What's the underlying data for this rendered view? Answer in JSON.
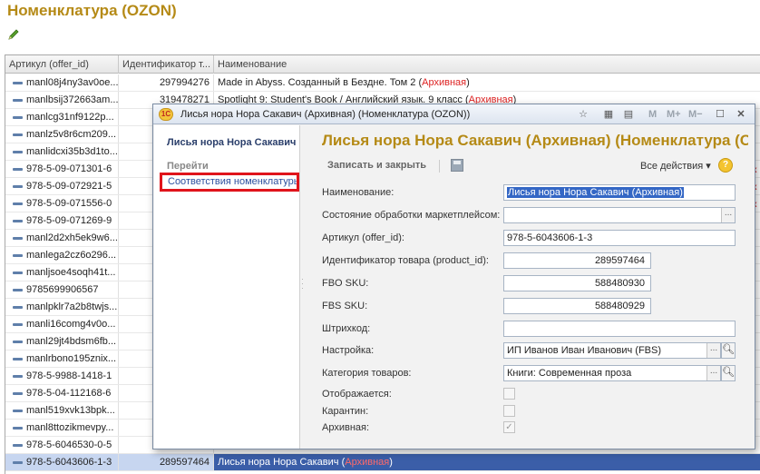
{
  "page": {
    "title": "Номенклатура (OZON)"
  },
  "grid": {
    "columns": [
      "Артикул (offer_id)",
      "Идентификатор т...",
      "Наименование"
    ],
    "rows": [
      {
        "art": "manl08j4ny3av0oe...",
        "id": "297994276",
        "name": "Made in Abyss. Созданный в Бездне. Том 2 (",
        "archive": "Архивная",
        "close": ")"
      },
      {
        "art": "manlbsij372663am...",
        "id": "319478271",
        "name": "Spotlight 9: Student's Book / Английский язык. 9 класс (",
        "archive": "Архивная",
        "close": ")"
      },
      {
        "art": "manlcg31nf9122p...",
        "id": "",
        "name": "",
        "archive": "",
        "close": ""
      },
      {
        "art": "manlz5v8r6cm209...",
        "id": "",
        "name": "",
        "archive": "",
        "close": ""
      },
      {
        "art": "manlidcxi35b3d1to...",
        "id": "",
        "name": "",
        "archive": "",
        "close": ""
      },
      {
        "art": "978-5-09-071301-6",
        "id": "",
        "name": "",
        "archive": "",
        "close": ""
      },
      {
        "art": "978-5-09-072921-5",
        "id": "",
        "name": "",
        "archive": "",
        "close": ""
      },
      {
        "art": "978-5-09-071556-0",
        "id": "",
        "name": "",
        "archive": "",
        "close": ""
      },
      {
        "art": "978-5-09-071269-9",
        "id": "",
        "name": "",
        "archive": "",
        "close": ""
      },
      {
        "art": "manl2d2xh5ek9w6...",
        "id": "",
        "name": "",
        "archive": "",
        "close": ""
      },
      {
        "art": "manlega2cz6o296...",
        "id": "",
        "name": "",
        "archive": "",
        "close": ""
      },
      {
        "art": "manljsoe4soqh41t...",
        "id": "",
        "name": "",
        "archive": "",
        "close": ""
      },
      {
        "art": "9785699906567",
        "id": "",
        "name": "",
        "archive": "",
        "close": ""
      },
      {
        "art": "manlpklr7a2b8twjs...",
        "id": "",
        "name": "",
        "archive": "",
        "close": ""
      },
      {
        "art": "manli16comg4v0o...",
        "id": "",
        "name": "",
        "archive": "",
        "close": ""
      },
      {
        "art": "manl29jt4bdsm6fb...",
        "id": "",
        "name": "",
        "archive": "",
        "close": ""
      },
      {
        "art": "manlrbono195znix...",
        "id": "",
        "name": "",
        "archive": "",
        "close": ""
      },
      {
        "art": "978-5-9988-1418-1",
        "id": "",
        "name": "",
        "archive": "",
        "close": ""
      },
      {
        "art": "978-5-04-112168-6",
        "id": "",
        "name": "",
        "archive": "",
        "close": ""
      },
      {
        "art": "manl519xvk13bpk...",
        "id": "",
        "name": "",
        "archive": "",
        "close": ""
      },
      {
        "art": "manl8ttozikmevpy...",
        "id": "",
        "name": "",
        "archive": "",
        "close": ""
      },
      {
        "art": "978-5-6046530-0-5",
        "id": "",
        "name": "",
        "archive": "",
        "close": ""
      },
      {
        "art": "978-5-6043606-1-3",
        "id": "289597464",
        "name": "Лисья нора Нора Сакавич (",
        "archive": "Архивная",
        "close": ")"
      }
    ],
    "edge_marks": [
      "к",
      "к",
      "к"
    ]
  },
  "modal": {
    "window_title": "Лисья нора Нора Сакавич (Архивная) (Номенклатура (OZON))",
    "toolbar_m": "M",
    "toolbar_mplus": "M+",
    "toolbar_mminus": "M−",
    "nav": {
      "title": "Лисья нора Нора Сакавич (Архивная)",
      "goto": "Перейти",
      "link": "Соответствия номенклатуры"
    },
    "form_title": "Лисья нора Нора Сакавич (Архивная) (Номенклатура (OZON))",
    "save_close": "Записать и закрыть",
    "all_actions": "Все действия ▾",
    "help": "?",
    "fields": {
      "name_label": "Наименование:",
      "name_value": "Лисья нора Нора Сакавич (Архивная)",
      "state_label": "Состояние обработки маркетплейсом:",
      "state_value": "",
      "offer_label": "Артикул (offer_id):",
      "offer_value": "978-5-6043606-1-3",
      "product_label": "Идентификатор товара (product_id):",
      "product_value": "289597464",
      "fbo_label": "FBO SKU:",
      "fbo_value": "588480930",
      "fbs_label": "FBS SKU:",
      "fbs_value": "588480929",
      "barcode_label": "Штрихкод:",
      "barcode_value": "",
      "setting_label": "Настройка:",
      "setting_value": "ИП Иванов Иван Иванович (FBS)",
      "category_label": "Категория товаров:",
      "category_value": "Книги: Современная проза",
      "shown_label": "Отображается:",
      "quarantine_label": "Карантин:",
      "archive_label": "Архивная:",
      "archive_checked": "✓"
    }
  }
}
